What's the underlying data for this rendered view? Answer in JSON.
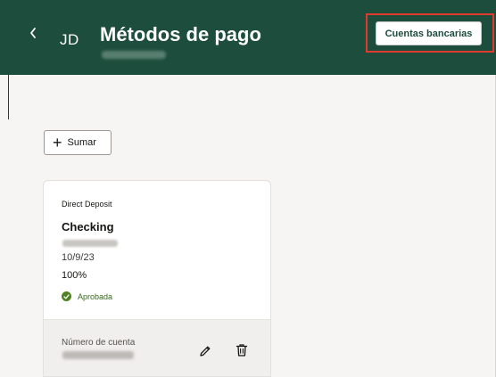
{
  "header": {
    "back_icon": "chevron-left-icon",
    "avatar_initials": "JD",
    "title": "Métodos de pago",
    "bank_accounts_button": "Cuentas bancarias",
    "background_color": "#1d4d3c",
    "highlight_color": "#e03a2e"
  },
  "toolbar": {
    "add_icon": "plus-icon",
    "add_label": "Sumar"
  },
  "card": {
    "type": "Direct Deposit",
    "name": "Checking",
    "date": "10/9/23",
    "percentage": "100%",
    "status": "Aprobada",
    "status_color": "#508223",
    "account_number_label": "Número de cuenta",
    "edit_icon": "pencil-icon",
    "delete_icon": "trash-icon"
  }
}
